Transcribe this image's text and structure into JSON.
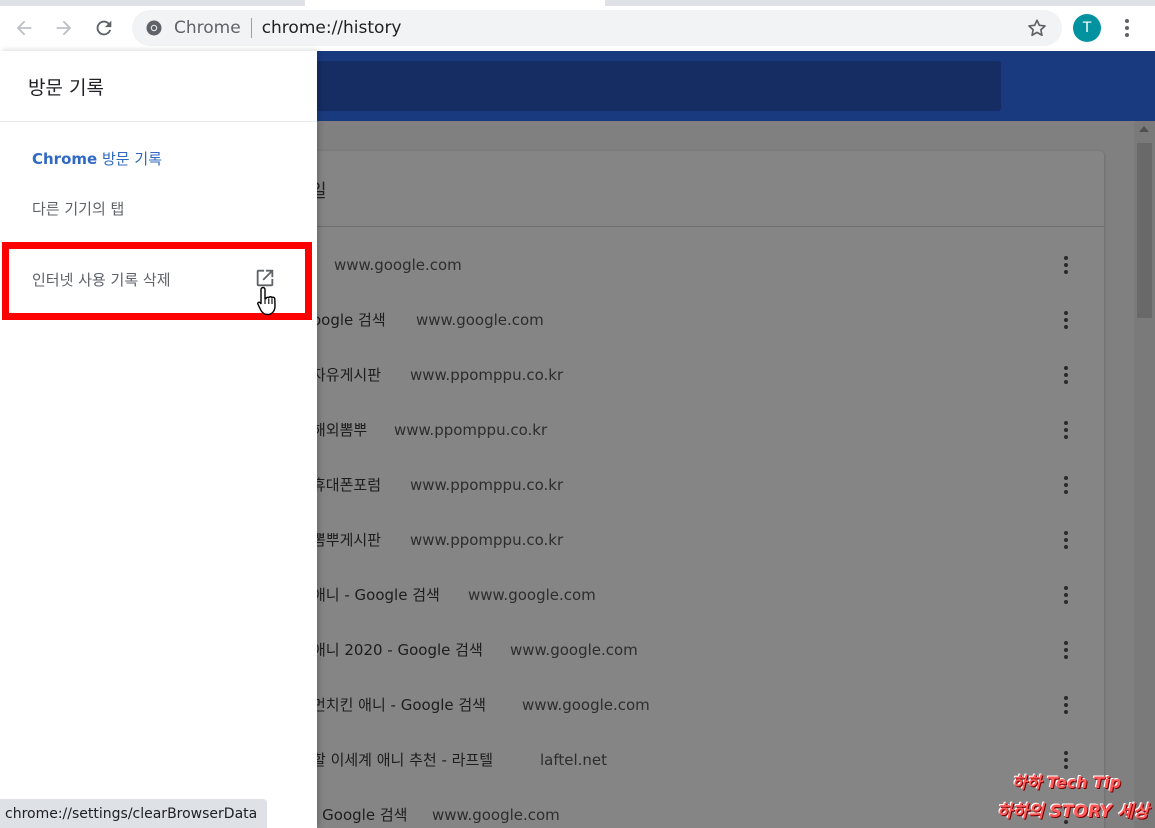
{
  "toolbar": {
    "back_icon": "back-arrow-icon",
    "forward_icon": "forward-arrow-icon",
    "reload_icon": "reload-icon",
    "site_label": "Chrome",
    "url": "chrome://history",
    "avatar_initial": "T"
  },
  "drawer": {
    "title": "방문 기록",
    "items": [
      {
        "label_bold": "Chrome",
        "label_rest": " 방문 기록",
        "selected": true
      },
      {
        "label": "다른 기기의 탭",
        "selected": false
      },
      {
        "label": "인터넷 사용 기록 삭제",
        "selected": false
      }
    ]
  },
  "history": {
    "card_title": "일",
    "rows": [
      {
        "title": "",
        "domain": "www.google.com"
      },
      {
        "title": "oogle 검색",
        "domain": "www.google.com"
      },
      {
        "title": "자유게시판",
        "domain": "www.ppomppu.co.kr"
      },
      {
        "title": "해외뽐뿌",
        "domain": "www.ppomppu.co.kr"
      },
      {
        "title": "휴대폰포럼",
        "domain": "www.ppomppu.co.kr"
      },
      {
        "title": "뽐뿌게시판",
        "domain": "www.ppomppu.co.kr"
      },
      {
        "title": "애니 - Google 검색",
        "domain": "www.google.com"
      },
      {
        "title": "애니 2020 - Google 검색",
        "domain": "www.google.com"
      },
      {
        "title": "먼치킨 애니 - Google 검색",
        "domain": "www.google.com"
      },
      {
        "title": "할 이세계 애니 추천 - 라프텔",
        "domain": "laftel.net"
      },
      {
        "title": "- Google 검색",
        "domain": "www.google.com"
      }
    ]
  },
  "status_bar": {
    "url": "chrome://settings/clearBrowserData"
  },
  "watermark": {
    "line1": "하하 Tech Tip",
    "line2": "하하의 STORY 세상"
  },
  "colors": {
    "header": "#1a3a80",
    "avatar": "#00939f",
    "selected_item": "#2f69c2",
    "highlight": "#ff0000"
  }
}
